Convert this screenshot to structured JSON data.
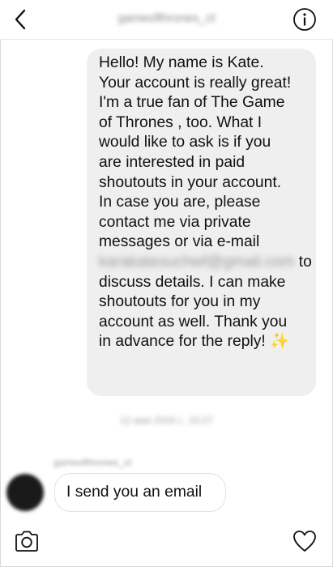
{
  "header": {
    "title": "gameofthrones_ct",
    "back_icon": "chevron-left-icon",
    "info_icon": "info-circle-icon"
  },
  "messages": {
    "outgoing": {
      "lines": [
        "Hello! My name is Kate.",
        "Your account is really great!",
        "I'm a true fan of The Game",
        "of Thrones , too. What I",
        "would like to ask is if you",
        "are interested in paid",
        "shoutouts in your account.",
        "In case you are, please",
        "contact me via private",
        "messages or via e-mail"
      ],
      "email": "karakatesuchwf@gmail.com",
      "email_suffix": " to",
      "lines_after": [
        "discuss details. I can make",
        "shoutouts for you in my",
        "account as well. Thank you"
      ],
      "last_line": "in advance for the reply! ",
      "emoji": "✨"
    },
    "timestamp": "12 мая 2016 г., 15:27",
    "incoming": {
      "sender": "gameofthrones_ct",
      "text": "I send you an email"
    }
  },
  "footer": {
    "camera_icon": "camera-icon",
    "heart_icon": "heart-icon"
  },
  "colors": {
    "bubble_out": "#efefef",
    "bubble_in_border": "#e2e2e2",
    "text": "#111111"
  }
}
